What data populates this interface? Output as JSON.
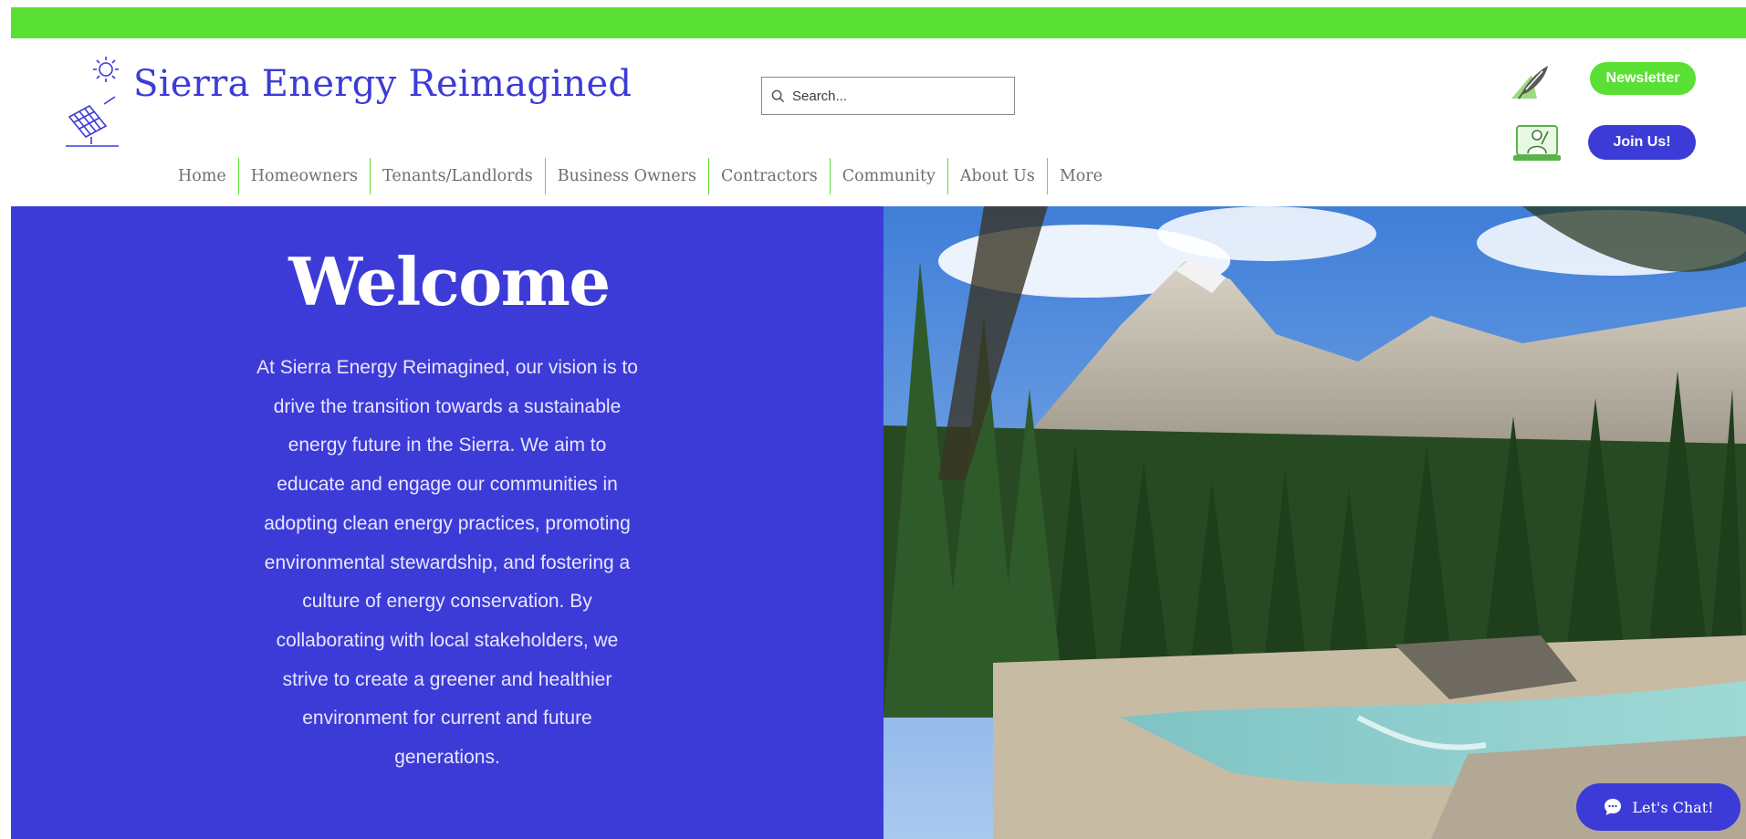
{
  "header": {
    "brand": "Sierra Energy Reimagined",
    "logo_icon": "solar-panel-sun-icon",
    "search": {
      "placeholder": "Search..."
    },
    "nav": [
      {
        "label": "Home"
      },
      {
        "label": "Homeowners"
      },
      {
        "label": "Tenants/Landlords"
      },
      {
        "label": "Business Owners"
      },
      {
        "label": "Contractors"
      },
      {
        "label": "Community"
      },
      {
        "label": "About Us"
      },
      {
        "label": "More"
      }
    ],
    "newsletter_label": "Newsletter",
    "join_label": "Join Us!"
  },
  "hero": {
    "title": "Welcome",
    "body": "At Sierra Energy Reimagined, our vision is to drive the transition towards a sustainable energy future in the Sierra. We aim to educate and engage our communities in adopting clean energy practices, promoting environmental stewardship, and fostering a culture of energy conservation. By collaborating with local stakeholders, we strive to create a greener and healthier environment for current and future generations.",
    "photo": "mountain-river-forest-photo"
  },
  "chat": {
    "label": "Let's Chat!"
  },
  "colors": {
    "accent_green": "#5ae034",
    "brand_blue": "#3d3bd7"
  }
}
